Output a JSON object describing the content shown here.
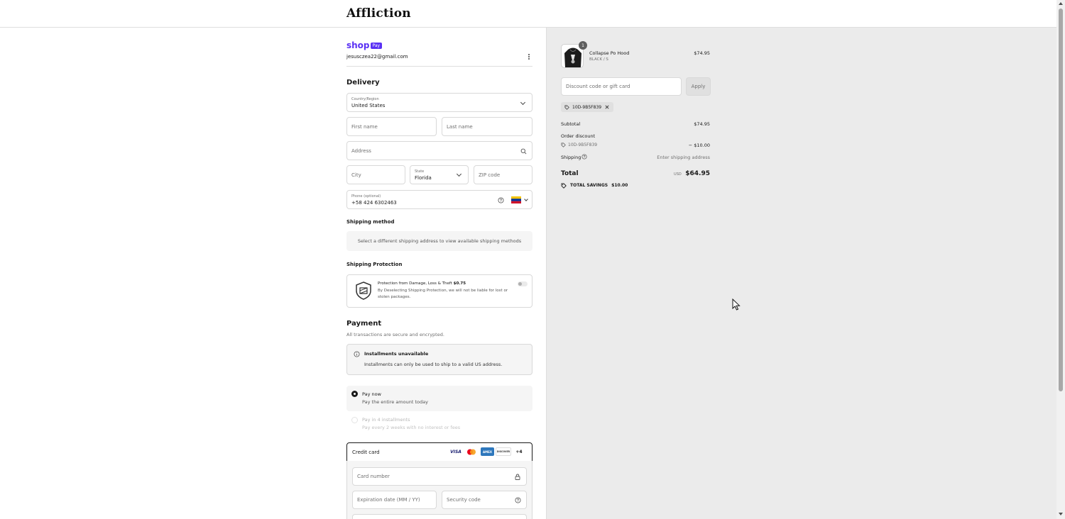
{
  "brand": {
    "logo_text": "Affliction"
  },
  "shop_pay": {
    "shop": "shop",
    "pay": "Pay"
  },
  "account": {
    "email": "jesusczea22@gmail.com"
  },
  "delivery": {
    "heading": "Delivery",
    "country_label": "Country/Region",
    "country_value": "United States",
    "first_name_placeholder": "First name",
    "last_name_placeholder": "Last name",
    "address_placeholder": "Address",
    "city_placeholder": "City",
    "state_label": "State",
    "state_value": "Florida",
    "zip_placeholder": "ZIP code",
    "phone_label": "Phone (optional)",
    "phone_value": "+58 424 6302463"
  },
  "shipping_method": {
    "heading": "Shipping method",
    "message": "Select a different shipping address to view available shipping methods"
  },
  "shipping_protection": {
    "heading": "Shipping Protection",
    "title": "Protection from Damage, Loss & Theft",
    "price": "$0.75",
    "description": "By Deselecting Shipping Protection, we will not be liable for lost or stolen packages."
  },
  "payment": {
    "heading": "Payment",
    "subheading": "All transactions are secure and encrypted.",
    "installments_title": "Installments unavailable",
    "installments_text": "Installments can only be used to ship to a valid US address.",
    "pay_now_label": "Pay now",
    "pay_now_sub": "Pay the entire amount today",
    "pay_in_4_label": "Pay in 4 installments",
    "pay_in_4_sub": "Pay every 2 weeks with no interest or fees",
    "credit_card_label": "Credit card",
    "card_logos": {
      "visa": "VISA",
      "amex": "AMEX",
      "discover": "DISCOVER",
      "more": "+4"
    },
    "card_number_placeholder": "Card number",
    "expiry_placeholder": "Expiration date (MM / YY)",
    "security_placeholder": "Security code"
  },
  "order": {
    "item_quantity": "1",
    "item_name": "Collapse Po Hood",
    "item_variant": "BLACK / S",
    "item_price": "$74.95",
    "discount_placeholder": "Discount code or gift card",
    "apply_label": "Apply",
    "discount_code": "10D-9B5F839",
    "subtotal_label": "Subtotal",
    "subtotal_value": "$74.95",
    "order_discount_label": "Order discount",
    "order_discount_code": "10D-9B5F839",
    "order_discount_value": "− $10.00",
    "shipping_label": "Shipping",
    "shipping_value": "Enter shipping address",
    "total_label": "Total",
    "total_currency": "USD",
    "total_value": "$64.95",
    "total_savings_label": "TOTAL SAVINGS",
    "total_savings_value": "$10.00"
  },
  "colors": {
    "accent": "#5a31f4",
    "panel_bg": "#ebebeb",
    "border": "#d9d9d9",
    "text": "#1a1a1a"
  }
}
